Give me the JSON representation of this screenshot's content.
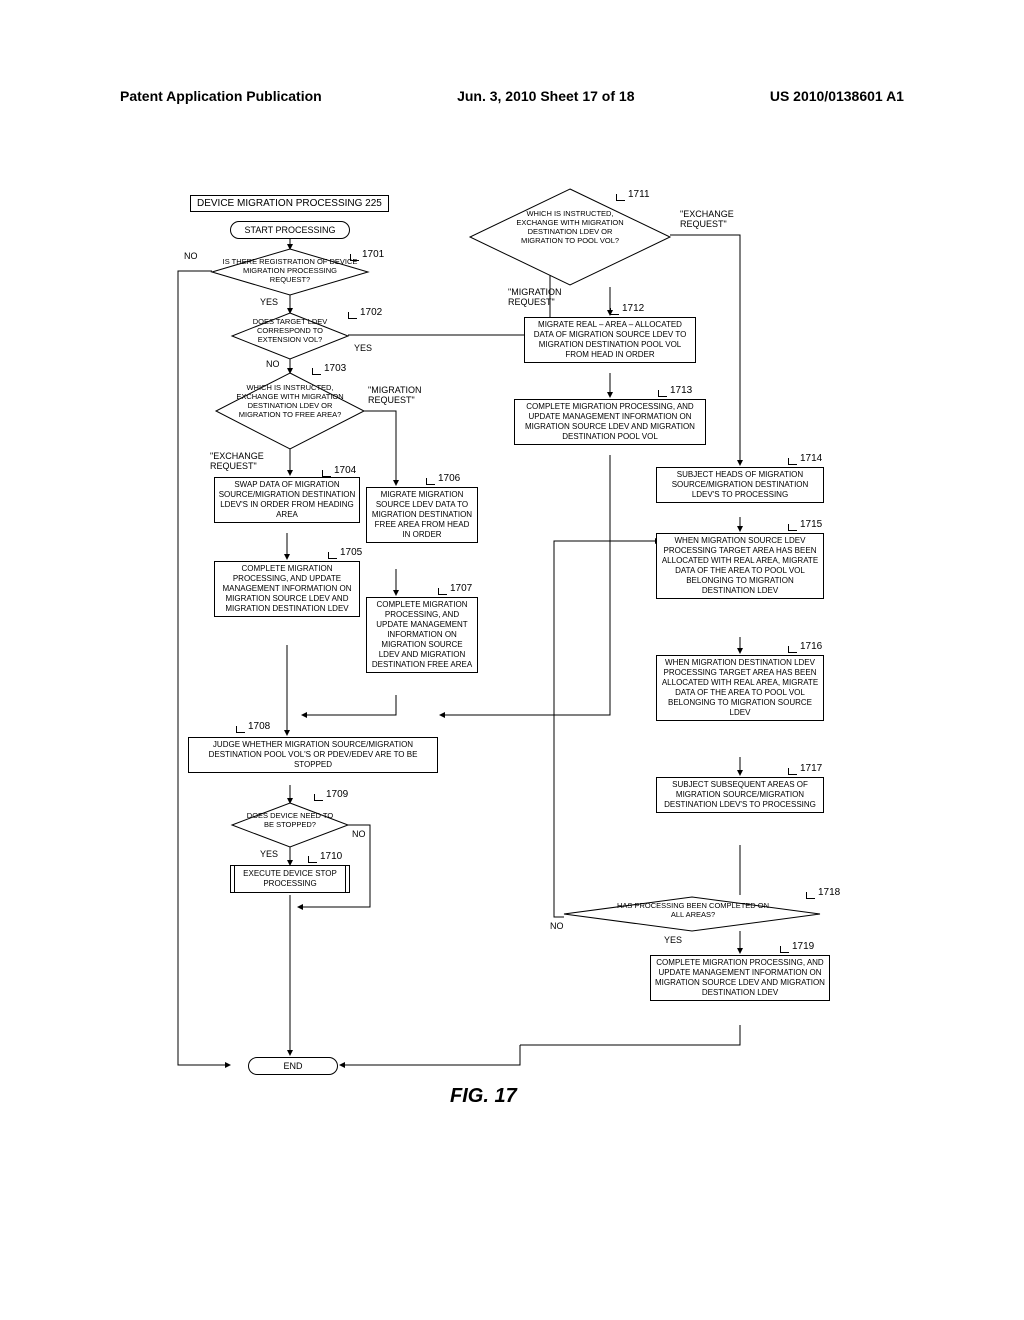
{
  "header": {
    "left": "Patent Application Publication",
    "center": "Jun. 3, 2010  Sheet 17 of 18",
    "right": "US 2010/0138601 A1"
  },
  "title": "DEVICE MIGRATION PROCESSING 225",
  "start": "START PROCESSING",
  "end": "END",
  "refs": {
    "r1701": "1701",
    "r1702": "1702",
    "r1703": "1703",
    "r1704": "1704",
    "r1705": "1705",
    "r1706": "1706",
    "r1707": "1707",
    "r1708": "1708",
    "r1709": "1709",
    "r1710": "1710",
    "r1711": "1711",
    "r1712": "1712",
    "r1713": "1713",
    "r1714": "1714",
    "r1715": "1715",
    "r1716": "1716",
    "r1717": "1717",
    "r1718": "1718",
    "r1719": "1719"
  },
  "d1701": "IS THERE REGISTRATION OF DEVICE MIGRATION PROCESSING REQUEST?",
  "d1702": "DOES TARGET LDEV CORRESPOND TO EXTENSION VOL?",
  "d1703": "WHICH IS INSTRUCTED, EXCHANGE WITH MIGRATION DESTINATION LDEV OR MIGRATION TO FREE AREA?",
  "p1704": "SWAP DATA OF MIGRATION SOURCE/MIGRATION DESTINATION LDEV'S IN ORDER FROM HEADING AREA",
  "p1705": "COMPLETE MIGRATION PROCESSING, AND UPDATE MANAGEMENT INFORMATION ON MIGRATION SOURCE LDEV AND MIGRATION DESTINATION LDEV",
  "p1706": "MIGRATE MIGRATION SOURCE LDEV DATA TO MIGRATION DESTINATION FREE AREA FROM HEAD IN ORDER",
  "p1707": "COMPLETE MIGRATION PROCESSING, AND UPDATE MANAGEMENT INFORMATION ON MIGRATION SOURCE LDEV AND MIGRATION DESTINATION FREE AREA",
  "p1708": "JUDGE WHETHER MIGRATION SOURCE/MIGRATION DESTINATION POOL VOL'S OR PDEV/EDEV ARE TO BE STOPPED",
  "d1709": "DOES DEVICE NEED TO BE STOPPED?",
  "p1710": "EXECUTE DEVICE STOP PROCESSING",
  "d1711": "WHICH IS INSTRUCTED, EXCHANGE WITH MIGRATION DESTINATION LDEV OR MIGRATION TO POOL VOL?",
  "p1712": "MIGRATE REAL – AREA – ALLOCATED DATA OF MIGRATION SOURCE LDEV TO MIGRATION DESTINATION POOL VOL FROM HEAD IN ORDER",
  "p1713": "COMPLETE MIGRATION PROCESSING, AND UPDATE MANAGEMENT INFORMATION ON MIGRATION SOURCE LDEV AND MIGRATION DESTINATION POOL VOL",
  "p1714": "SUBJECT HEADS OF MIGRATION SOURCE/MIGRATION DESTINATION LDEV'S TO PROCESSING",
  "p1715": "WHEN MIGRATION SOURCE LDEV PROCESSING TARGET AREA HAS BEEN ALLOCATED WITH REAL AREA, MIGRATE DATA OF THE AREA TO POOL VOL BELONGING TO MIGRATION DESTINATION LDEV",
  "p1716": "WHEN MIGRATION DESTINATION LDEV PROCESSING TARGET AREA HAS BEEN ALLOCATED WITH REAL AREA, MIGRATE DATA OF THE AREA TO POOL VOL BELONGING TO MIGRATION SOURCE LDEV",
  "p1717": "SUBJECT SUBSEQUENT AREAS OF MIGRATION SOURCE/MIGRATION DESTINATION LDEV'S TO PROCESSING",
  "d1718": "HAS PROCESSING BEEN COMPLETED ON ALL AREAS?",
  "p1719": "COMPLETE MIGRATION PROCESSING, AND UPDATE MANAGEMENT INFORMATION ON MIGRATION SOURCE LDEV AND MIGRATION DESTINATION LDEV",
  "labels": {
    "yes": "YES",
    "no": "NO",
    "migration_req": "\"MIGRATION REQUEST\"",
    "exchange_req": "\"EXCHANGE REQUEST\""
  },
  "figcap": "FIG. 17"
}
